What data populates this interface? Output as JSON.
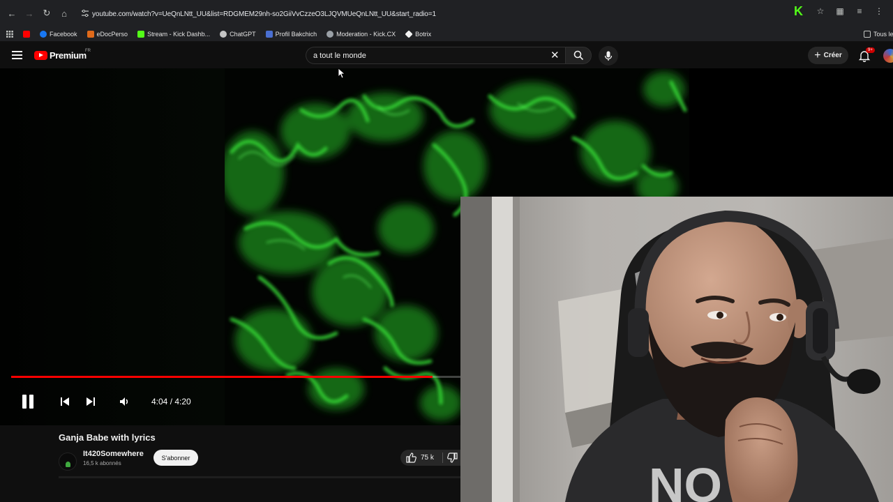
{
  "browser": {
    "url": "youtube.com/watch?v=UeQnLNtt_UU&list=RDGMEM29nh-so2GiiVvCzzeO3LJQVMUeQnLNtt_UU&start_radio=1",
    "bookmarks": [
      {
        "label": "",
        "color": "#ff0000"
      },
      {
        "label": "Facebook",
        "color": "#1877f2"
      },
      {
        "label": "eDocPerso",
        "color": "#e06a1a"
      },
      {
        "label": "Stream - Kick Dashb...",
        "color": "#53fc18"
      },
      {
        "label": "ChatGPT",
        "color": "#c4c4c4"
      },
      {
        "label": "Profil Bakchich",
        "color": "#4a6fd1"
      },
      {
        "label": "Moderation - Kick.CX",
        "color": "#9aa0a6"
      },
      {
        "label": "Botrix",
        "color": "#f1f1f1"
      }
    ],
    "bookmarks_all": "Tous les"
  },
  "header": {
    "logo_text": "Premium",
    "country": "FR",
    "search_value": "a tout le monde",
    "create_label": "Créer",
    "notification_badge": "9+"
  },
  "player": {
    "time": "4:04 / 4:20",
    "progress_fraction": 0.938
  },
  "video": {
    "title": "Ganja Babe with lyrics",
    "channel": "It420Somewhere",
    "subscribers": "16,5 k abonnés",
    "subscribe_label": "S'abonner",
    "likes": "75 k"
  },
  "colors": {
    "accent": "#ff0000",
    "kick_green": "#53fc18",
    "smoke_green": "#2fc42f"
  }
}
